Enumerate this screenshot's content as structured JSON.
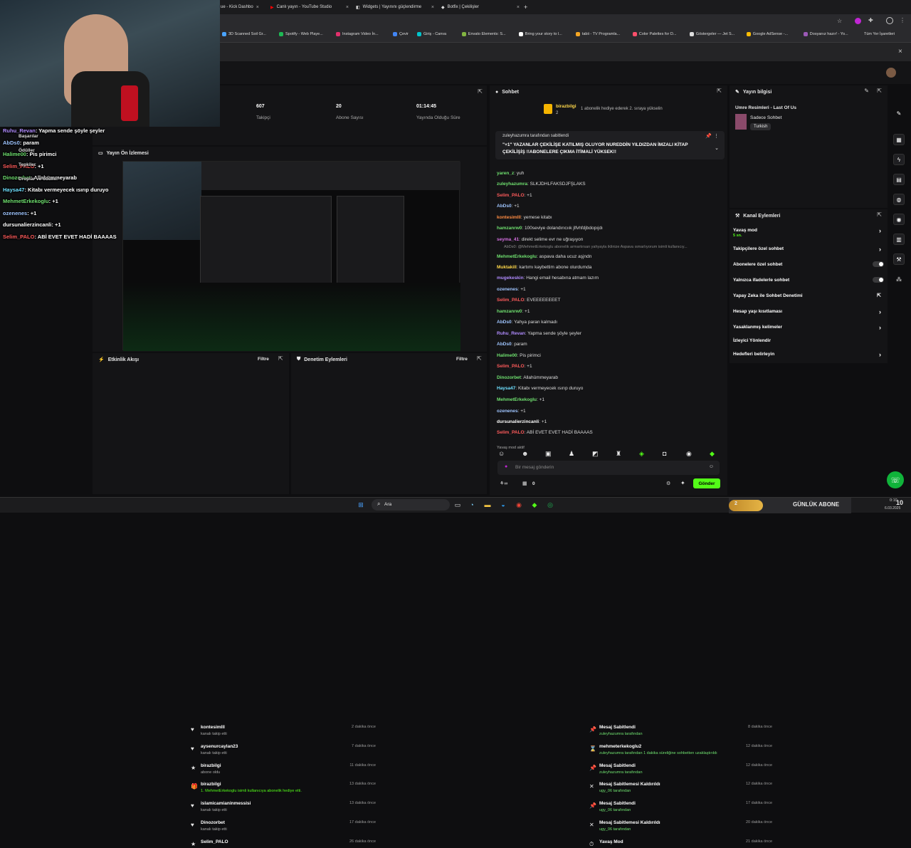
{
  "browser": {
    "tabs": [
      {
        "label": "ue - Kick Dashbo"
      },
      {
        "label": "Canlı yayın - YouTube Studio"
      },
      {
        "label": "Widgets | Yayınını güçlendirme"
      },
      {
        "label": "Botfix | Çekilişler"
      }
    ],
    "new_tab": "+",
    "bookmarks": [
      {
        "label": "3D Scanned Soil Gr...",
        "color": "#4aa3ff"
      },
      {
        "label": "Spotify - Web Playe...",
        "color": "#1db954"
      },
      {
        "label": "Instagram Video İn...",
        "color": "#e1306c"
      },
      {
        "label": "Çevir",
        "color": "#4285f4"
      },
      {
        "label": "Giriş - Canva",
        "color": "#00c4cc"
      },
      {
        "label": "Envato Elements: S...",
        "color": "#82b541"
      },
      {
        "label": "Bring your story to l...",
        "color": "#fff"
      },
      {
        "label": "tabii - TV Programla...",
        "color": "#f5a623"
      },
      {
        "label": "Color Palettes for D...",
        "color": "#ff4f6b"
      },
      {
        "label": "Göstergeler — Jet S...",
        "color": "#ddd"
      },
      {
        "label": "Google AdSense -...",
        "color": "#fbbc05"
      },
      {
        "label": "Dosyanız hazır! - Yo...",
        "color": "#9b59b6"
      }
    ],
    "all_bookmarks": "Tüm Yer İşaretleri",
    "infobar_close": "×"
  },
  "stats": [
    {
      "value": "607",
      "label": "Takipçi"
    },
    {
      "value": "20",
      "label": "Abone Sayısı"
    },
    {
      "value": "01:14:45",
      "label": "Yayında Olduğu Süre"
    }
  ],
  "preview": {
    "title": "Yayın Ön İzlemesi"
  },
  "webcam_overlay": {
    "lines": [
      {
        "user": "Ruhu_Revan",
        "text": ": Yapma sende şöyle şeyler",
        "color": "#b18cff"
      },
      {
        "user": "AbDs0",
        "text": ": param",
        "color": "#9fc5ff"
      },
      {
        "user": "Halime00",
        "text": ": Pis pirimci",
        "color": "#6fe06f"
      },
      {
        "user": "Selim_PALO",
        "text": ": +1",
        "color": "#ff5b5b"
      },
      {
        "user": "Dinozorbet",
        "text": ": Allahümmeyarab",
        "color": "#6fe06f"
      },
      {
        "user": "Haysa47",
        "text": ": Kitabı vermeyecek ısırıp duruyo",
        "color": "#6fe0ff"
      },
      {
        "user": "MehmetErkekoglu",
        "text": ": +1",
        "color": "#6fe06f"
      },
      {
        "user": "ozenenes",
        "text": ": +1",
        "color": "#9fc5ff"
      },
      {
        "user": "dursunalierzincanli",
        "text": ": +1",
        "color": "#ffffff"
      },
      {
        "user": "Selim_PALO",
        "text": ": ABİ EVET EVET HADİ BAAAAS",
        "color": "#ff5b5b"
      }
    ],
    "menu": [
      "Başarılar",
      "Ödüller",
      "Tepkiler",
      "Droplar ve ödüller"
    ]
  },
  "events": {
    "title": "Etkinlik Akışı",
    "filter": "Filtre",
    "items": [
      {
        "title": "kontesimlll",
        "sub": "kanalı takip etti",
        "time": "2 dakika önce",
        "icon": "♥"
      },
      {
        "title": "aysenurcaylan23",
        "sub": "kanalı takip etti",
        "time": "7 dakika önce",
        "icon": "♥"
      },
      {
        "title": "birazbilgi",
        "sub": "abone oldu",
        "time": "11 dakika önce",
        "icon": "★"
      },
      {
        "title": "birazbilgi",
        "sub": "1. MehmetErkekoglu isimli kullanıcıya abonelik hediye etti.",
        "time": "13 dakika önce",
        "icon": "🎁"
      },
      {
        "title": "islamicamianinmessisi",
        "sub": "kanalı takip etti",
        "time": "13 dakika önce",
        "icon": "♥"
      },
      {
        "title": "Dinozorbet",
        "sub": "kanalı takip etti",
        "time": "17 dakika önce",
        "icon": "♥"
      },
      {
        "title": "Selim_PALO",
        "sub": "",
        "time": "26 dakika önce",
        "icon": "★"
      }
    ]
  },
  "moderation": {
    "title": "Denetim Eylemleri",
    "filter": "Filtre",
    "items": [
      {
        "title": "Mesaj Sabitlendi",
        "sub": "zuleyhazumra tarafından",
        "time": "8 dakika önce",
        "icon": "📌"
      },
      {
        "title": "mehmeterkekoglu2",
        "sub": "zuleyhazumra tarafından 1 dakika süreliğine sohbetten uzaklaştırıldı",
        "time": "12 dakika önce",
        "icon": "⌛"
      },
      {
        "title": "Mesaj Sabitlendi",
        "sub": "zuleyhazumra tarafından",
        "time": "12 dakika önce",
        "icon": "📌"
      },
      {
        "title": "Mesaj Sabitlemesi Kaldırıldı",
        "sub": "ugy_06 tarafından",
        "time": "12 dakika önce",
        "icon": "✕"
      },
      {
        "title": "Mesaj Sabitlendi",
        "sub": "ugy_06 tarafından",
        "time": "17 dakika önce",
        "icon": "📌"
      },
      {
        "title": "Mesaj Sabitlemesi Kaldırıldı",
        "sub": "ugy_06 tarafından",
        "time": "20 dakika önce",
        "icon": "✕"
      },
      {
        "title": "Yavaş Mod",
        "sub": "",
        "time": "21 dakika önce",
        "icon": "⏱"
      }
    ]
  },
  "chat": {
    "title": "Sohbet",
    "gift_user": "birazbilgi",
    "gift_count": "2",
    "gift_text": "1 abonelik hediye ederek 2. sıraya yükselin",
    "pinned_by": "zuleyhazumra tarafından sabitlendi",
    "pinned_text1": "\"+1\" YAZANLAR ÇEKİLİŞE KATILMIŞ OLUYOR NUREDDİN YILDIZDAN İMZALI KİTAP",
    "pinned_text2": "ÇEKİLİŞİŞ !!ABONELERE ÇIKMA İTİMALİ YÜKSEK!!",
    "messages": [
      {
        "user": "yaren_z",
        "text": ": yuh",
        "color": "#6fe06f"
      },
      {
        "user": "zuleyhazumra",
        "text": ": SLKJDHLFAKSDJFŞLAKS",
        "color": "#6fe06f"
      },
      {
        "user": "Selim_PALO",
        "text": ": +1",
        "color": "#ff5b5b"
      },
      {
        "user": "AbDs0",
        "text": ": +1",
        "color": "#9fc5ff"
      },
      {
        "user": "kontesimlll",
        "text": ": yemese kitabı",
        "color": "#ff8c42"
      },
      {
        "user": "hamzanrw0",
        "text": ": 100seviye dolandırıcıık jlfvhfdjbdopıjdı",
        "color": "#6fe06f"
      },
      {
        "user": "seyma_41",
        "text": ": direkt selime evr ne uğraşıyon",
        "color": "#d46fe0"
      },
      {
        "user": "MehmetErkekoglu",
        "text": ": aspava daha ucuz aşjndn",
        "color": "#6fe06f"
      },
      {
        "user": "Muktakill",
        "text": ": kartımı kaybettim abone olurdumda",
        "color": "#ffd84a"
      },
      {
        "user": "mugekeskin",
        "text": ": Hangi email hesabına atmam lazım",
        "color": "#b18cff"
      },
      {
        "user": "ozenenes",
        "text": ": +1",
        "color": "#9fc5ff"
      },
      {
        "user": "Selim_PALO",
        "text": ": EVEEEEEEEET",
        "color": "#ff5b5b"
      },
      {
        "user": "hamzanrw0",
        "text": ": +1",
        "color": "#6fe06f"
      },
      {
        "user": "AbDs0",
        "text": ": Yahya paran kalmadı",
        "color": "#9fc5ff"
      },
      {
        "user": "Ruhu_Revan",
        "text": ": Yapma sende şöyle şeyler",
        "color": "#b18cff"
      },
      {
        "user": "AbDs0",
        "text": ": param",
        "color": "#9fc5ff"
      },
      {
        "user": "Halime00",
        "text": ": Pis pirimci",
        "color": "#6fe06f"
      },
      {
        "user": "Selim_PALO",
        "text": ": +1",
        "color": "#ff5b5b"
      },
      {
        "user": "Dinozorbet",
        "text": ": Allahümmeyarab",
        "color": "#6fe06f"
      },
      {
        "user": "Haysa47",
        "text": ": Kitabı vermeyecek ısırıp duruyo",
        "color": "#6fe0ff"
      },
      {
        "user": "MehmetErkekoglu",
        "text": ": +1",
        "color": "#6fe06f"
      },
      {
        "user": "ozenenes",
        "text": ": +1",
        "color": "#9fc5ff"
      },
      {
        "user": "dursunalierzincanli",
        "text": ": +1",
        "color": "#ffffff"
      },
      {
        "user": "Selim_PALO",
        "text": ": ABİ EVET EVET HADİ BAAAAS",
        "color": "#ff5b5b"
      }
    ],
    "reply_line": "AbDs0: @MehmetErkekoglu abonelik armartırsan yahyayla iklinize Aspava ısmarlıyorum isimli kullanıcıy...",
    "slow_mode": "Yavaş mod aktif",
    "placeholder": "Bir mesaj gönderin",
    "send": "Gönder",
    "points": "0"
  },
  "stream_info": {
    "title": "Yayın bilgisi",
    "category_title": "Umre Resimleri - Last Of Us",
    "mode": "Sadece Sohbet",
    "language": "Turkish"
  },
  "channel_actions": {
    "title": "Kanal Eylemleri",
    "items": [
      {
        "label": "Yavaş mod",
        "sub": "5 sn.",
        "kind": "chevron"
      },
      {
        "label": "Takipçilere özel sohbet",
        "kind": "chevron"
      },
      {
        "label": "Abonelere özel sohbet",
        "kind": "toggle"
      },
      {
        "label": "Yalnızca ifadelerle sohbet",
        "kind": "toggle"
      },
      {
        "label": "Yapay Zeka ile Sohbet Denetimi",
        "kind": "link"
      },
      {
        "label": "Hesap yaşı kısıtlaması",
        "kind": "chevron"
      },
      {
        "label": "Yasaklanmış kelimeler",
        "kind": "chevron"
      },
      {
        "label": "İzleyici Yönlendir",
        "kind": "none"
      },
      {
        "label": "Hedefleri belirleyin",
        "kind": "chevron"
      }
    ]
  },
  "taskbar": {
    "search": "Ara",
    "goal_count": "2",
    "goal_label": "GÜNLÜK ABONE",
    "goal_value": "10",
    "time": "0:10",
    "date": "6.03.2025"
  },
  "colors": {
    "accent": "#53fc18",
    "bg": "#0e0e10",
    "panel": "#141416"
  }
}
